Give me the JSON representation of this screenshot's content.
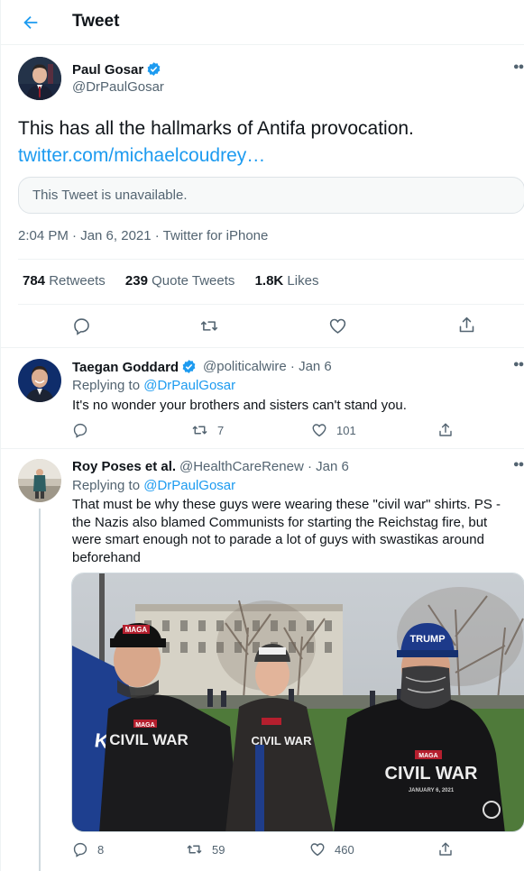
{
  "header": {
    "title": "Tweet",
    "back_icon": "arrow-left-icon"
  },
  "main_tweet": {
    "name": "Paul Gosar",
    "handle": "@DrPaulGosar",
    "text": "This has all the hallmarks of Antifa provocation.",
    "link": "twitter.com/michaelcoudrey…",
    "unavailable": "This Tweet is unavailable.",
    "meta": "2:04 PM · Jan 6, 2021 · Twitter for iPhone",
    "stats": {
      "retweets_count": "784",
      "retweets_label": "Retweets",
      "quotes_count": "239",
      "quotes_label": "Quote Tweets",
      "likes_count": "1.8K",
      "likes_label": "Likes"
    }
  },
  "replies": [
    {
      "name": "Taegan Goddard",
      "handle_date": "@politicalwire · Jan 6",
      "replying_to_label": "Replying to",
      "replying_to": "@DrPaulGosar",
      "text": "It's no wonder your brothers and sisters can't stand you.",
      "replies": "",
      "retweets": "7",
      "likes": "101"
    },
    {
      "name": "Roy Poses et al.",
      "handle_date": "@HealthCareRenew · Jan 6",
      "replying_to_label": "Replying to",
      "replying_to": "@DrPaulGosar",
      "text": "That must be why these guys were wearing these \"civil war\" shirts.  PS - the Nazis also blamed Communists for starting the Reichstag fire, but were smart enough not to parade a lot of guys with swastikas around beforehand",
      "replies": "8",
      "retweets": "59",
      "likes": "460",
      "photo_texts": {
        "cap_left": "MAGA",
        "cap_right": "TRUMP",
        "flag": "KE",
        "shirt_left": "CIVIL WAR",
        "shirt_middle": "CIVIL WAR",
        "shirt_right_tag": "MAGA",
        "shirt_right": "CIVIL WAR",
        "shirt_right_date": "JANUARY 6, 2021"
      }
    }
  ],
  "colors": {
    "accent": "#1d9bf0",
    "secondary": "#536471",
    "verified": "#1d9bf0"
  }
}
